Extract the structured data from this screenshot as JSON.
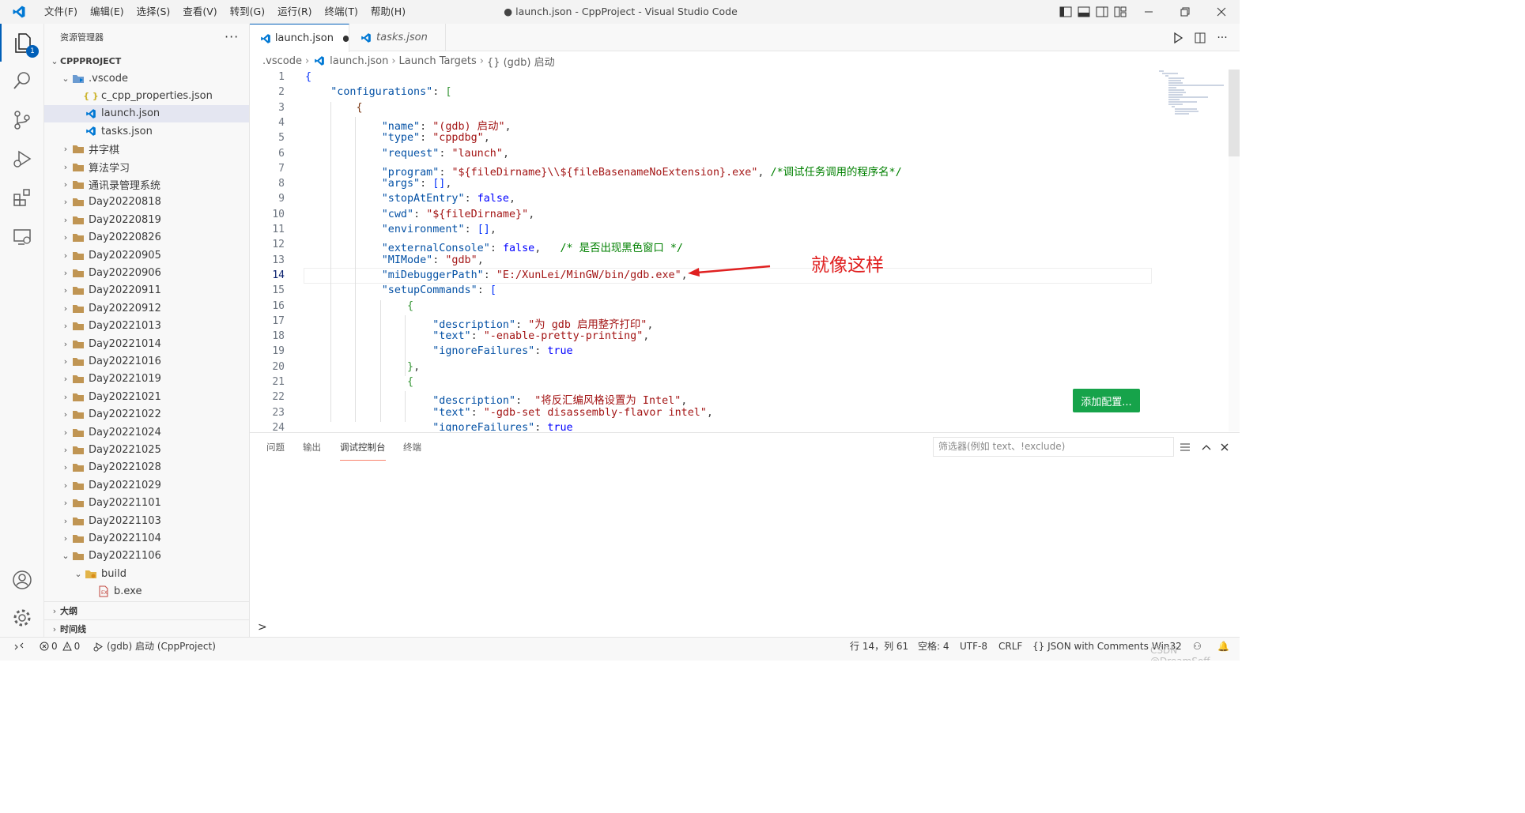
{
  "window": {
    "title": "● launch.json - CppProject - Visual Studio Code",
    "menu": [
      "文件(F)",
      "编辑(E)",
      "选择(S)",
      "查看(V)",
      "转到(G)",
      "运行(R)",
      "终端(T)",
      "帮助(H)"
    ]
  },
  "activity": {
    "explorer_badge": "1"
  },
  "explorer": {
    "header": "资源管理器",
    "more": "···",
    "project": "CPPPROJECT",
    "items": [
      {
        "label": ".vscode",
        "depth": 1,
        "kind": "vscode-folder",
        "expanded": true
      },
      {
        "label": "c_cpp_properties.json",
        "depth": 2,
        "kind": "json"
      },
      {
        "label": "launch.json",
        "depth": 2,
        "kind": "vscode-json",
        "selected": true
      },
      {
        "label": "tasks.json",
        "depth": 2,
        "kind": "vscode-json"
      },
      {
        "label": "井字棋",
        "depth": 1,
        "kind": "folder"
      },
      {
        "label": "算法学习",
        "depth": 1,
        "kind": "folder"
      },
      {
        "label": "通讯录管理系统",
        "depth": 1,
        "kind": "folder"
      },
      {
        "label": "Day20220818",
        "depth": 1,
        "kind": "folder"
      },
      {
        "label": "Day20220819",
        "depth": 1,
        "kind": "folder"
      },
      {
        "label": "Day20220826",
        "depth": 1,
        "kind": "folder"
      },
      {
        "label": "Day20220905",
        "depth": 1,
        "kind": "folder"
      },
      {
        "label": "Day20220906",
        "depth": 1,
        "kind": "folder"
      },
      {
        "label": "Day20220911",
        "depth": 1,
        "kind": "folder"
      },
      {
        "label": "Day20220912",
        "depth": 1,
        "kind": "folder"
      },
      {
        "label": "Day20221013",
        "depth": 1,
        "kind": "folder"
      },
      {
        "label": "Day20221014",
        "depth": 1,
        "kind": "folder"
      },
      {
        "label": "Day20221016",
        "depth": 1,
        "kind": "folder"
      },
      {
        "label": "Day20221019",
        "depth": 1,
        "kind": "folder"
      },
      {
        "label": "Day20221021",
        "depth": 1,
        "kind": "folder"
      },
      {
        "label": "Day20221022",
        "depth": 1,
        "kind": "folder"
      },
      {
        "label": "Day20221024",
        "depth": 1,
        "kind": "folder"
      },
      {
        "label": "Day20221025",
        "depth": 1,
        "kind": "folder"
      },
      {
        "label": "Day20221028",
        "depth": 1,
        "kind": "folder"
      },
      {
        "label": "Day20221029",
        "depth": 1,
        "kind": "folder"
      },
      {
        "label": "Day20221101",
        "depth": 1,
        "kind": "folder"
      },
      {
        "label": "Day20221103",
        "depth": 1,
        "kind": "folder"
      },
      {
        "label": "Day20221104",
        "depth": 1,
        "kind": "folder"
      },
      {
        "label": "Day20221106",
        "depth": 1,
        "kind": "folder",
        "expanded": true
      },
      {
        "label": "build",
        "depth": 2,
        "kind": "build-folder",
        "expanded": true
      },
      {
        "label": "b.exe",
        "depth": 3,
        "kind": "exe"
      }
    ],
    "outline": "大纲",
    "timeline": "时间线"
  },
  "tabs": [
    {
      "label": "launch.json",
      "dirty": true
    },
    {
      "label": "tasks.json"
    }
  ],
  "breadcrumb": [
    ".vscode",
    "launch.json",
    "Launch Targets",
    "{} (gdb) 启动"
  ],
  "editor": {
    "current_line": 14,
    "line_numbers": [
      "1",
      "2",
      "3",
      "4",
      "5",
      "6",
      "7",
      "8",
      "9",
      "10",
      "11",
      "12",
      "13",
      "14",
      "15",
      "16",
      "17",
      "18",
      "19",
      "20",
      "21",
      "22",
      "23",
      "24"
    ],
    "lines": [
      [
        [
          "br1",
          "{"
        ]
      ],
      [
        [
          "sp",
          "    "
        ],
        [
          "k",
          "\"configurations\""
        ],
        [
          "p",
          ": "
        ],
        [
          "br2",
          "["
        ]
      ],
      [
        [
          "sp",
          "        "
        ],
        [
          "br3",
          "{"
        ]
      ],
      [
        [
          "sp",
          "            "
        ],
        [
          "k",
          "\"name\""
        ],
        [
          "p",
          ": "
        ],
        [
          "s",
          "\"(gdb) 启动\""
        ],
        [
          "p",
          ","
        ]
      ],
      [
        [
          "sp",
          "            "
        ],
        [
          "k",
          "\"type\""
        ],
        [
          "p",
          ": "
        ],
        [
          "s",
          "\"cppdbg\""
        ],
        [
          "p",
          ","
        ]
      ],
      [
        [
          "sp",
          "            "
        ],
        [
          "k",
          "\"request\""
        ],
        [
          "p",
          ": "
        ],
        [
          "s",
          "\"launch\""
        ],
        [
          "p",
          ","
        ]
      ],
      [
        [
          "sp",
          "            "
        ],
        [
          "k",
          "\"program\""
        ],
        [
          "p",
          ": "
        ],
        [
          "s",
          "\"${fileDirname}\\\\${fileBasenameNoExtension}.exe\""
        ],
        [
          "p",
          ", "
        ],
        [
          "c",
          "/*调试任务调用的程序名*/"
        ]
      ],
      [
        [
          "sp",
          "            "
        ],
        [
          "k",
          "\"args\""
        ],
        [
          "p",
          ": "
        ],
        [
          "br1",
          "[]"
        ],
        [
          "p",
          ","
        ]
      ],
      [
        [
          "sp",
          "            "
        ],
        [
          "k",
          "\"stopAtEntry\""
        ],
        [
          "p",
          ": "
        ],
        [
          "b",
          "false"
        ],
        [
          "p",
          ","
        ]
      ],
      [
        [
          "sp",
          "            "
        ],
        [
          "k",
          "\"cwd\""
        ],
        [
          "p",
          ": "
        ],
        [
          "s",
          "\"${fileDirname}\""
        ],
        [
          "p",
          ","
        ]
      ],
      [
        [
          "sp",
          "            "
        ],
        [
          "k",
          "\"environment\""
        ],
        [
          "p",
          ": "
        ],
        [
          "br1",
          "[]"
        ],
        [
          "p",
          ","
        ]
      ],
      [
        [
          "sp",
          "            "
        ],
        [
          "k",
          "\"externalConsole\""
        ],
        [
          "p",
          ": "
        ],
        [
          "b",
          "false"
        ],
        [
          "p",
          ",   "
        ],
        [
          "c",
          "/* 是否出现黑色窗口 */"
        ]
      ],
      [
        [
          "sp",
          "            "
        ],
        [
          "k",
          "\"MIMode\""
        ],
        [
          "p",
          ": "
        ],
        [
          "s",
          "\"gdb\""
        ],
        [
          "p",
          ","
        ]
      ],
      [
        [
          "sp",
          "            "
        ],
        [
          "k",
          "\"miDebuggerPath\""
        ],
        [
          "p",
          ": "
        ],
        [
          "s",
          "\"E:/XunLei/MinGW/bin/gdb.exe\""
        ],
        [
          "p",
          ","
        ]
      ],
      [
        [
          "sp",
          "            "
        ],
        [
          "k",
          "\"setupCommands\""
        ],
        [
          "p",
          ": "
        ],
        [
          "br1",
          "["
        ]
      ],
      [
        [
          "sp",
          "                "
        ],
        [
          "br2",
          "{"
        ]
      ],
      [
        [
          "sp",
          "                    "
        ],
        [
          "k",
          "\"description\""
        ],
        [
          "p",
          ": "
        ],
        [
          "s",
          "\"为 gdb 启用整齐打印\""
        ],
        [
          "p",
          ","
        ]
      ],
      [
        [
          "sp",
          "                    "
        ],
        [
          "k",
          "\"text\""
        ],
        [
          "p",
          ": "
        ],
        [
          "s",
          "\"-enable-pretty-printing\""
        ],
        [
          "p",
          ","
        ]
      ],
      [
        [
          "sp",
          "                    "
        ],
        [
          "k",
          "\"ignoreFailures\""
        ],
        [
          "p",
          ": "
        ],
        [
          "b",
          "true"
        ]
      ],
      [
        [
          "sp",
          "                "
        ],
        [
          "br2",
          "}"
        ],
        [
          "p",
          ","
        ]
      ],
      [
        [
          "sp",
          "                "
        ],
        [
          "br2",
          "{"
        ]
      ],
      [
        [
          "sp",
          "                    "
        ],
        [
          "k",
          "\"description\""
        ],
        [
          "p",
          ":  "
        ],
        [
          "s",
          "\"将反汇编风格设置为 Intel\""
        ],
        [
          "p",
          ","
        ]
      ],
      [
        [
          "sp",
          "                    "
        ],
        [
          "k",
          "\"text\""
        ],
        [
          "p",
          ": "
        ],
        [
          "s",
          "\"-gdb-set disassembly-flavor intel\""
        ],
        [
          "p",
          ","
        ]
      ],
      [
        [
          "sp",
          "                    "
        ],
        [
          "k",
          "\"ignoreFailures\""
        ],
        [
          "p",
          ": "
        ],
        [
          "b",
          "true"
        ]
      ]
    ],
    "annotation": "就像这样",
    "add_config": "添加配置..."
  },
  "panel": {
    "tabs": [
      "问题",
      "输出",
      "调试控制台",
      "终端"
    ],
    "active_tab": 2,
    "filter_placeholder": "筛选器(例如 text、!exclude)",
    "prompt": ">"
  },
  "status": {
    "errors": "0",
    "warnings": "0",
    "debug_config": "(gdb) 启动 (CppProject)",
    "position": "行 14，列 61",
    "indent": "空格: 4",
    "encoding": "UTF-8",
    "eol": "CRLF",
    "language": "JSON with Comments",
    "platform": "Win32",
    "watermark": "CSDN @DreamSoff"
  },
  "colors": {
    "accent": "#005fb8",
    "annotation": "#e02020",
    "button": "#16a34a"
  }
}
